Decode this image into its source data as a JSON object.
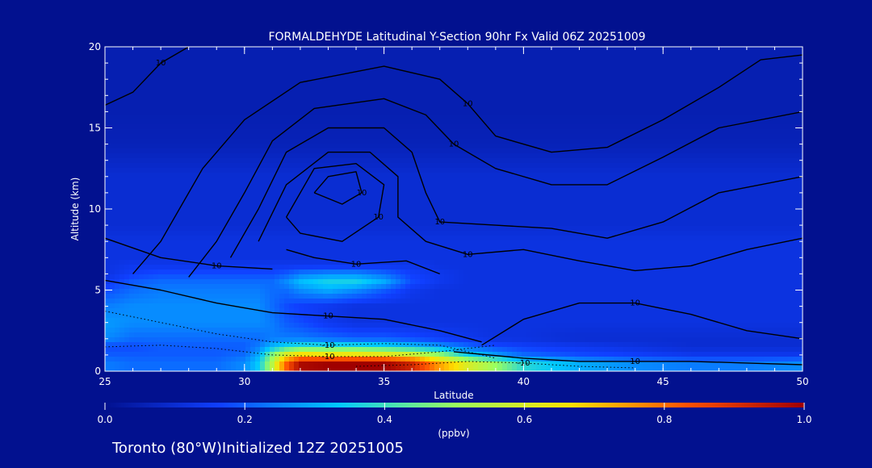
{
  "chart_data": {
    "type": "heatmap",
    "title": "FORMALDEHYDE Latitudinal Y-Section 90hr  Fx Valid 06Z 20251009",
    "xlabel": "Latitude",
    "ylabel": "Altitude (km)",
    "xlim": [
      25,
      50
    ],
    "ylim": [
      0,
      20
    ],
    "x_ticks": [
      "25",
      "30",
      "35",
      "40",
      "45",
      "50"
    ],
    "y_ticks": [
      "0",
      "5",
      "10",
      "15",
      "20"
    ],
    "colorbar": {
      "min": 0.0,
      "max": 1.0,
      "ticks": [
        "0.0",
        "0.2",
        "0.4",
        "0.6",
        "0.8",
        "1.0"
      ],
      "unit": "(ppbv)",
      "colors": [
        "#02118f",
        "#1040ff",
        "#00c8ff",
        "#9aff60",
        "#ffe000",
        "#ff5000",
        "#a00000"
      ]
    },
    "field": {
      "x": [
        25,
        26,
        27,
        28,
        29,
        30,
        30.5,
        31,
        31.5,
        32,
        33,
        34,
        35,
        36,
        37,
        38,
        39,
        40,
        42,
        44,
        46,
        48,
        50
      ],
      "y": [
        0,
        0.5,
        1,
        1.5,
        2,
        3,
        4,
        5,
        5.5,
        6,
        6.5,
        7,
        8,
        9,
        10,
        12,
        14,
        16,
        18,
        20
      ],
      "values": [
        [
          0.24,
          0.22,
          0.22,
          0.22,
          0.22,
          0.26,
          0.34,
          0.55,
          0.82,
          0.98,
          1.0,
          1.0,
          1.0,
          0.92,
          0.74,
          0.6,
          0.5,
          0.38,
          0.3,
          0.26,
          0.24,
          0.24,
          0.26
        ],
        [
          0.24,
          0.22,
          0.22,
          0.22,
          0.22,
          0.26,
          0.34,
          0.55,
          0.82,
          0.98,
          1.0,
          1.0,
          1.0,
          0.92,
          0.74,
          0.6,
          0.5,
          0.38,
          0.3,
          0.26,
          0.24,
          0.24,
          0.26
        ],
        [
          0.2,
          0.2,
          0.2,
          0.2,
          0.2,
          0.22,
          0.3,
          0.48,
          0.62,
          0.68,
          0.66,
          0.66,
          0.64,
          0.6,
          0.5,
          0.36,
          0.28,
          0.22,
          0.18,
          0.16,
          0.14,
          0.14,
          0.14
        ],
        [
          0.18,
          0.18,
          0.2,
          0.2,
          0.2,
          0.2,
          0.24,
          0.32,
          0.38,
          0.4,
          0.4,
          0.4,
          0.38,
          0.34,
          0.28,
          0.22,
          0.18,
          0.16,
          0.14,
          0.12,
          0.1,
          0.1,
          0.1
        ],
        [
          0.26,
          0.22,
          0.22,
          0.22,
          0.22,
          0.22,
          0.22,
          0.24,
          0.24,
          0.24,
          0.22,
          0.2,
          0.2,
          0.18,
          0.16,
          0.14,
          0.12,
          0.12,
          0.1,
          0.1,
          0.1,
          0.1,
          0.1
        ],
        [
          0.28,
          0.26,
          0.26,
          0.26,
          0.26,
          0.26,
          0.26,
          0.24,
          0.2,
          0.18,
          0.14,
          0.12,
          0.12,
          0.12,
          0.12,
          0.12,
          0.12,
          0.12,
          0.12,
          0.12,
          0.12,
          0.12,
          0.12
        ],
        [
          0.24,
          0.26,
          0.26,
          0.26,
          0.26,
          0.26,
          0.26,
          0.22,
          0.18,
          0.16,
          0.14,
          0.12,
          0.12,
          0.12,
          0.12,
          0.12,
          0.12,
          0.12,
          0.12,
          0.12,
          0.12,
          0.12,
          0.12
        ],
        [
          0.18,
          0.22,
          0.24,
          0.24,
          0.24,
          0.24,
          0.24,
          0.22,
          0.22,
          0.26,
          0.3,
          0.26,
          0.2,
          0.14,
          0.12,
          0.12,
          0.12,
          0.12,
          0.12,
          0.12,
          0.12,
          0.12,
          0.12
        ],
        [
          0.14,
          0.2,
          0.22,
          0.22,
          0.22,
          0.22,
          0.22,
          0.22,
          0.26,
          0.32,
          0.36,
          0.36,
          0.3,
          0.18,
          0.14,
          0.12,
          0.12,
          0.12,
          0.12,
          0.12,
          0.12,
          0.12,
          0.12
        ],
        [
          0.12,
          0.16,
          0.18,
          0.18,
          0.18,
          0.18,
          0.18,
          0.18,
          0.2,
          0.24,
          0.26,
          0.26,
          0.22,
          0.16,
          0.14,
          0.12,
          0.12,
          0.12,
          0.12,
          0.12,
          0.12,
          0.12,
          0.12
        ],
        [
          0.12,
          0.14,
          0.14,
          0.14,
          0.14,
          0.14,
          0.14,
          0.14,
          0.14,
          0.14,
          0.14,
          0.14,
          0.14,
          0.14,
          0.12,
          0.12,
          0.12,
          0.12,
          0.12,
          0.12,
          0.12,
          0.12,
          0.12
        ],
        [
          0.12,
          0.12,
          0.12,
          0.12,
          0.12,
          0.12,
          0.12,
          0.12,
          0.12,
          0.12,
          0.12,
          0.12,
          0.12,
          0.12,
          0.12,
          0.12,
          0.12,
          0.12,
          0.12,
          0.12,
          0.12,
          0.12,
          0.12
        ],
        [
          0.12,
          0.12,
          0.12,
          0.12,
          0.12,
          0.12,
          0.12,
          0.12,
          0.12,
          0.12,
          0.12,
          0.12,
          0.12,
          0.12,
          0.12,
          0.12,
          0.12,
          0.12,
          0.12,
          0.12,
          0.12,
          0.12,
          0.12
        ],
        [
          0.1,
          0.1,
          0.1,
          0.1,
          0.1,
          0.1,
          0.1,
          0.1,
          0.1,
          0.1,
          0.1,
          0.1,
          0.1,
          0.1,
          0.1,
          0.1,
          0.1,
          0.1,
          0.1,
          0.1,
          0.1,
          0.1,
          0.1
        ],
        [
          0.1,
          0.1,
          0.1,
          0.1,
          0.1,
          0.1,
          0.1,
          0.1,
          0.1,
          0.1,
          0.1,
          0.1,
          0.1,
          0.1,
          0.1,
          0.1,
          0.1,
          0.1,
          0.1,
          0.1,
          0.1,
          0.1,
          0.1
        ],
        [
          0.1,
          0.1,
          0.1,
          0.1,
          0.1,
          0.1,
          0.1,
          0.1,
          0.1,
          0.1,
          0.1,
          0.1,
          0.1,
          0.1,
          0.1,
          0.1,
          0.1,
          0.1,
          0.1,
          0.1,
          0.1,
          0.1,
          0.1
        ],
        [
          0.06,
          0.06,
          0.06,
          0.06,
          0.06,
          0.06,
          0.06,
          0.06,
          0.06,
          0.06,
          0.06,
          0.06,
          0.06,
          0.06,
          0.06,
          0.06,
          0.06,
          0.06,
          0.06,
          0.06,
          0.06,
          0.06,
          0.06
        ],
        [
          0.05,
          0.05,
          0.05,
          0.05,
          0.05,
          0.05,
          0.05,
          0.05,
          0.05,
          0.05,
          0.05,
          0.05,
          0.05,
          0.05,
          0.05,
          0.05,
          0.05,
          0.05,
          0.05,
          0.05,
          0.05,
          0.05,
          0.05
        ],
        [
          0.05,
          0.05,
          0.05,
          0.05,
          0.05,
          0.05,
          0.05,
          0.05,
          0.05,
          0.05,
          0.05,
          0.05,
          0.05,
          0.05,
          0.05,
          0.05,
          0.05,
          0.05,
          0.05,
          0.05,
          0.05,
          0.05,
          0.05
        ],
        [
          0.05,
          0.05,
          0.05,
          0.05,
          0.05,
          0.05,
          0.05,
          0.05,
          0.05,
          0.05,
          0.05,
          0.05,
          0.05,
          0.05,
          0.05,
          0.05,
          0.05,
          0.05,
          0.05,
          0.05,
          0.05,
          0.05,
          0.05
        ]
      ]
    },
    "contours": [
      {
        "label": "10",
        "style": "solid",
        "points": [
          [
            25,
            16.4
          ],
          [
            26,
            17.2
          ],
          [
            27,
            19.0
          ],
          [
            28,
            20.0
          ]
        ]
      },
      {
        "label": "10",
        "style": "solid",
        "points": [
          [
            26,
            6.0
          ],
          [
            27,
            8.0
          ],
          [
            28.5,
            12.5
          ],
          [
            30,
            15.5
          ],
          [
            32,
            17.8
          ],
          [
            35,
            18.8
          ],
          [
            37,
            18.0
          ],
          [
            38,
            16.5
          ],
          [
            39,
            14.5
          ],
          [
            41,
            13.5
          ],
          [
            43,
            13.8
          ],
          [
            45,
            15.5
          ],
          [
            47,
            17.5
          ],
          [
            48.5,
            19.2
          ],
          [
            50,
            19.5
          ]
        ]
      },
      {
        "label": "10",
        "style": "solid",
        "points": [
          [
            28,
            5.8
          ],
          [
            29,
            8.0
          ],
          [
            30,
            11.0
          ],
          [
            31,
            14.2
          ],
          [
            32.5,
            16.2
          ],
          [
            35,
            16.8
          ],
          [
            36.5,
            15.8
          ],
          [
            37.5,
            14.0
          ],
          [
            39,
            12.5
          ],
          [
            41,
            11.5
          ],
          [
            43,
            11.5
          ],
          [
            45,
            13.2
          ],
          [
            47,
            15.0
          ],
          [
            50,
            16.0
          ]
        ]
      },
      {
        "label": "10",
        "style": "solid",
        "points": [
          [
            29.5,
            7.0
          ],
          [
            30.5,
            10.0
          ],
          [
            31.5,
            13.5
          ],
          [
            33,
            15.0
          ],
          [
            35,
            15.0
          ],
          [
            36,
            13.5
          ],
          [
            36.5,
            11.0
          ],
          [
            37,
            9.2
          ],
          [
            39,
            9.0
          ],
          [
            41,
            8.8
          ],
          [
            43,
            8.2
          ],
          [
            45,
            9.2
          ],
          [
            47,
            11.0
          ],
          [
            50,
            12.0
          ]
        ]
      },
      {
        "label": "10",
        "style": "solid",
        "points": [
          [
            30.5,
            8.0
          ],
          [
            31.5,
            11.5
          ],
          [
            33,
            13.5
          ],
          [
            34.5,
            13.5
          ],
          [
            35.5,
            12.0
          ],
          [
            35.5,
            9.5
          ],
          [
            36.5,
            8.0
          ],
          [
            38,
            7.2
          ],
          [
            40,
            7.5
          ],
          [
            42,
            6.8
          ],
          [
            44,
            6.2
          ],
          [
            46,
            6.5
          ],
          [
            48,
            7.5
          ],
          [
            50,
            8.2
          ]
        ]
      },
      {
        "label": "10",
        "style": "solid",
        "points": [
          [
            31.5,
            9.5
          ],
          [
            32.5,
            12.5
          ],
          [
            34,
            12.8
          ],
          [
            35,
            11.5
          ],
          [
            34.8,
            9.5
          ],
          [
            33.5,
            8.0
          ],
          [
            32,
            8.5
          ],
          [
            31.5,
            9.5
          ]
        ]
      },
      {
        "label": "10",
        "style": "solid",
        "points": [
          [
            32.5,
            11.0
          ],
          [
            33,
            12.0
          ],
          [
            34,
            12.3
          ],
          [
            34.2,
            11.0
          ],
          [
            33.5,
            10.3
          ],
          [
            32.5,
            11.0
          ]
        ]
      },
      {
        "label": "10",
        "style": "solid",
        "points": [
          [
            25,
            5.6
          ],
          [
            27,
            5.0
          ],
          [
            29,
            4.2
          ],
          [
            31,
            3.6
          ],
          [
            33,
            3.4
          ],
          [
            35,
            3.2
          ],
          [
            37,
            2.5
          ],
          [
            38.5,
            1.8
          ]
        ]
      },
      {
        "label": "10",
        "style": "solid",
        "points": [
          [
            38.5,
            1.6
          ],
          [
            40,
            3.2
          ],
          [
            42,
            4.2
          ],
          [
            44,
            4.2
          ],
          [
            46,
            3.5
          ],
          [
            48,
            2.5
          ],
          [
            50,
            2.0
          ]
        ]
      },
      {
        "label": "10",
        "style": "solid",
        "points": [
          [
            37.5,
            1.2
          ],
          [
            40,
            0.8
          ],
          [
            42,
            0.6
          ],
          [
            44,
            0.6
          ],
          [
            46,
            0.6
          ],
          [
            48,
            0.5
          ],
          [
            50,
            0.4
          ]
        ]
      },
      {
        "label": "10",
        "style": "solid",
        "points": [
          [
            31.5,
            7.5
          ],
          [
            32.5,
            7.0
          ],
          [
            34,
            6.6
          ],
          [
            35.8,
            6.8
          ],
          [
            37,
            6.0
          ]
        ]
      },
      {
        "label": "10",
        "style": "solid",
        "points": [
          [
            25,
            8.2
          ],
          [
            27,
            7.0
          ],
          [
            29,
            6.5
          ],
          [
            31,
            6.3
          ]
        ]
      },
      {
        "label": "-10",
        "style": "dotted",
        "points": [
          [
            25,
            1.5
          ],
          [
            27,
            1.6
          ],
          [
            29,
            1.4
          ],
          [
            31,
            1.0
          ],
          [
            33,
            0.9
          ],
          [
            35,
            0.9
          ],
          [
            37,
            1.2
          ],
          [
            39,
            1.6
          ]
        ]
      },
      {
        "label": "-10",
        "style": "dotted",
        "points": [
          [
            25,
            3.7
          ],
          [
            27,
            3.0
          ],
          [
            29,
            2.3
          ],
          [
            31,
            1.8
          ],
          [
            33,
            1.6
          ],
          [
            35,
            1.7
          ],
          [
            37,
            1.6
          ],
          [
            39,
            0.8
          ]
        ]
      },
      {
        "label": "-10",
        "style": "dotted",
        "points": [
          [
            34,
            0.3
          ],
          [
            36,
            0.4
          ],
          [
            38,
            0.6
          ],
          [
            40,
            0.5
          ],
          [
            42,
            0.3
          ],
          [
            44,
            0.2
          ]
        ]
      }
    ]
  },
  "footer": {
    "location": "Toronto (80°W)Initialized 12Z 20251005"
  }
}
